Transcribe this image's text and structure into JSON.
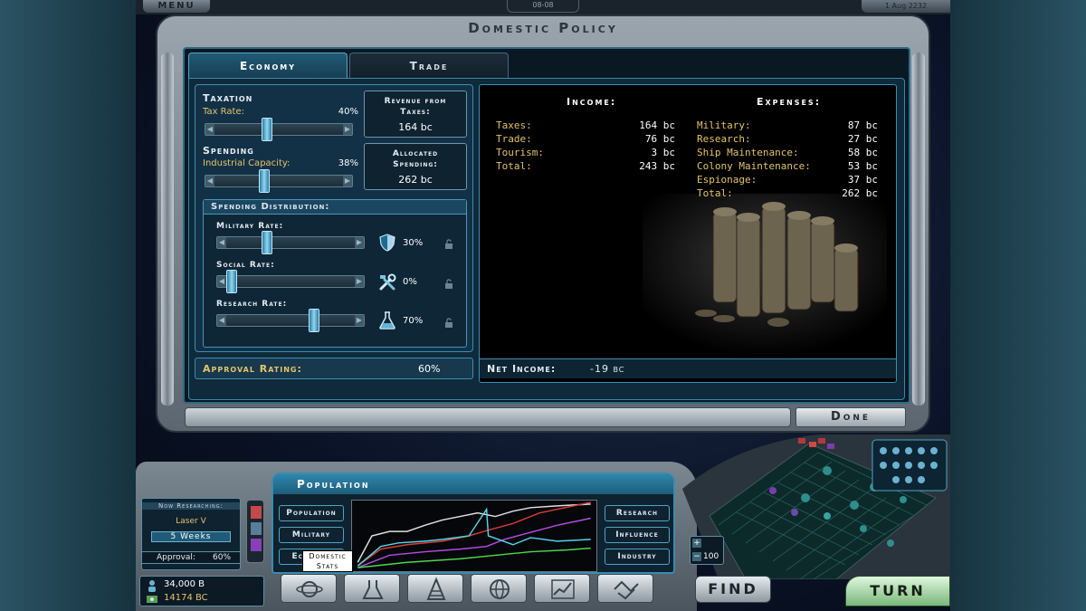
{
  "topbar": {
    "menu_label": "MENU",
    "stardate": "08-08",
    "date": "1 Aug 2232"
  },
  "window": {
    "title": "Domestic Policy",
    "done_label": "Done"
  },
  "tabs": [
    {
      "label": "Economy",
      "active": true
    },
    {
      "label": "Trade",
      "active": false
    }
  ],
  "taxation": {
    "title": "Taxation",
    "label": "Tax Rate:",
    "value": "40%",
    "slider_fraction": 0.4
  },
  "spending": {
    "title": "Spending",
    "label": "Industrial Capacity:",
    "value": "38%",
    "slider_fraction": 0.38
  },
  "revenue_box": {
    "title_1": "Revenue from",
    "title_2": "Taxes:",
    "value": "164 bc"
  },
  "allocated_box": {
    "title_1": "Allocated",
    "title_2": "Spending:",
    "value": "262 bc"
  },
  "distribution": {
    "title": "Spending Distribution:",
    "rates": [
      {
        "label": "Military Rate:",
        "value": "30%",
        "fraction": 0.3,
        "icon": "shield-icon"
      },
      {
        "label": "Social Rate:",
        "value": "0%",
        "fraction": 0.0,
        "icon": "tools-icon"
      },
      {
        "label": "Research Rate:",
        "value": "70%",
        "fraction": 0.7,
        "icon": "flask-icon"
      }
    ]
  },
  "approval": {
    "label": "Approval Rating:",
    "value": "60%"
  },
  "income": {
    "title": "Income:",
    "rows": [
      {
        "label": "Taxes:",
        "value": "164 bc"
      },
      {
        "label": "Trade:",
        "value": "76 bc"
      },
      {
        "label": "Tourism:",
        "value": "3 bc"
      },
      {
        "label": "Total:",
        "value": "243 bc"
      }
    ]
  },
  "expenses": {
    "title": "Expenses:",
    "rows": [
      {
        "label": "Military:",
        "value": "87 bc"
      },
      {
        "label": "Research:",
        "value": "27 bc"
      },
      {
        "label": "Ship Maintenance:",
        "value": "58 bc"
      },
      {
        "label": "Colony Maintenance:",
        "value": "53 bc"
      },
      {
        "label": "Espionage:",
        "value": "37 bc"
      },
      {
        "label": "Total:",
        "value": "262 bc"
      }
    ]
  },
  "net_income": {
    "label": "Net Income:",
    "value": "-19 bc"
  },
  "research": {
    "header": "Now Researching:",
    "name": "Laser V",
    "time": "5 Weeks"
  },
  "hud_approval": {
    "label": "Approval:",
    "value": "60%"
  },
  "money": {
    "credits": "34,000 B",
    "bc": "14174 BC"
  },
  "population_panel": {
    "title": "Population",
    "left_buttons": [
      "Population",
      "Military",
      "Economy"
    ],
    "right_buttons": [
      "Research",
      "Influence",
      "Industry"
    ],
    "tooltip_1": "Domestic",
    "tooltip_2": "Stats"
  },
  "buttons": {
    "find": "FIND",
    "turn": "TURN"
  },
  "zoom": {
    "value": "100",
    "plus": "+",
    "minus": "−"
  },
  "colors": {
    "accent": "#3d8db0",
    "gold": "#e3c46a",
    "panel": "#133146"
  }
}
